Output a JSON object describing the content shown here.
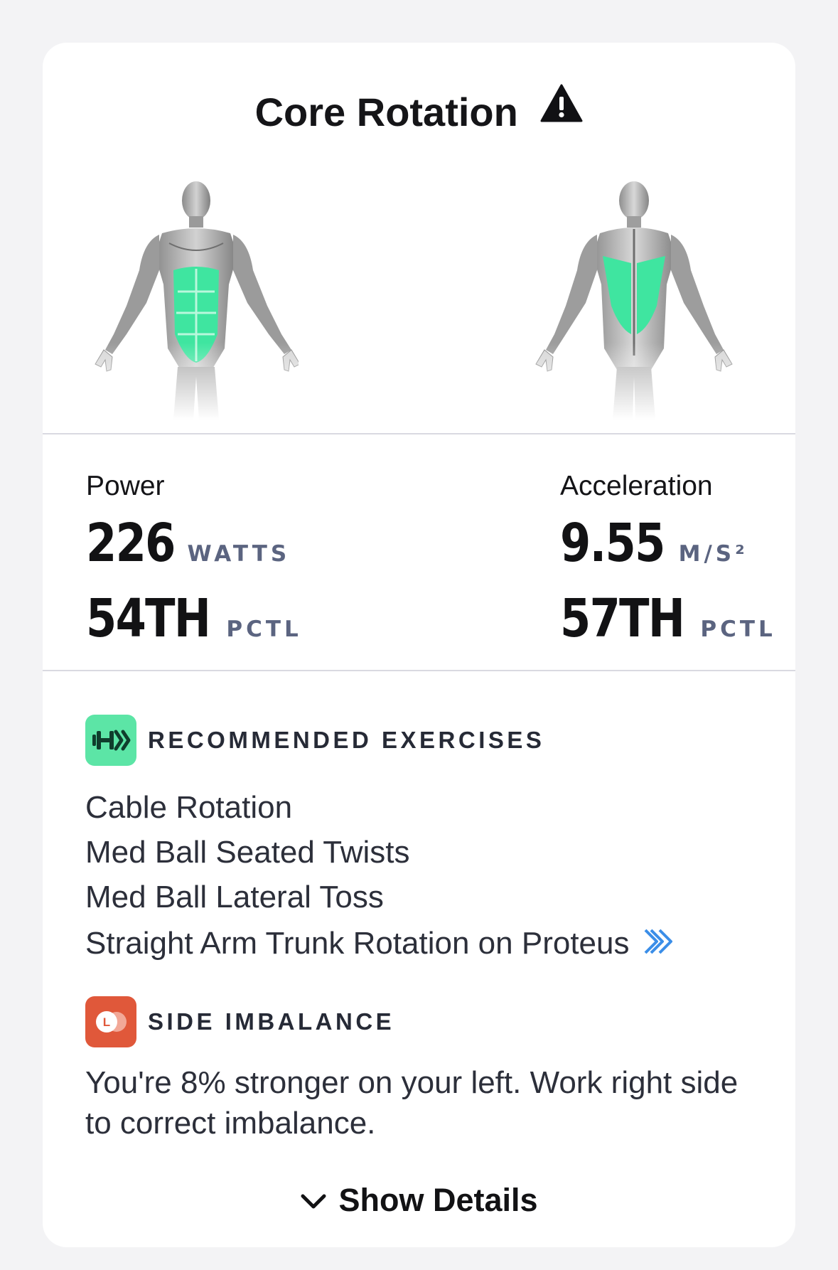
{
  "card": {
    "title": "Core Rotation",
    "title_icon": "warning-triangle-icon",
    "muscle_views": {
      "front": "front-muscle-diagram",
      "back": "back-muscle-diagram",
      "highlight_color": "#3fe5a0"
    }
  },
  "metrics": {
    "power": {
      "label": "Power",
      "value": "226",
      "unit": "WATTS",
      "percentile": "54TH",
      "percentile_unit": "PCTL"
    },
    "acceleration": {
      "label": "Acceleration",
      "value": "9.55",
      "unit": "M/S²",
      "percentile": "57TH",
      "percentile_unit": "PCTL"
    }
  },
  "recommended": {
    "heading": "RECOMMENDED EXERCISES",
    "icon": "dumbbell-icon",
    "icon_bg": "#5ce5a6",
    "items": [
      "Cable Rotation",
      "Med Ball Seated Twists",
      "Med Ball Lateral Toss",
      "Straight Arm Trunk Rotation on Proteus"
    ],
    "link_icon": "double-chevron-right-icon",
    "link_color": "#3b8ee8"
  },
  "imbalance": {
    "heading": "SIDE IMBALANCE",
    "icon": "left-right-toggle-icon",
    "icon_letter": "L",
    "icon_bg": "#e0583a",
    "text": "You're 8% stronger on your left. Work right side to correct imbalance."
  },
  "footer": {
    "show_details_label": "Show Details",
    "chevron_icon": "chevron-down-icon"
  }
}
